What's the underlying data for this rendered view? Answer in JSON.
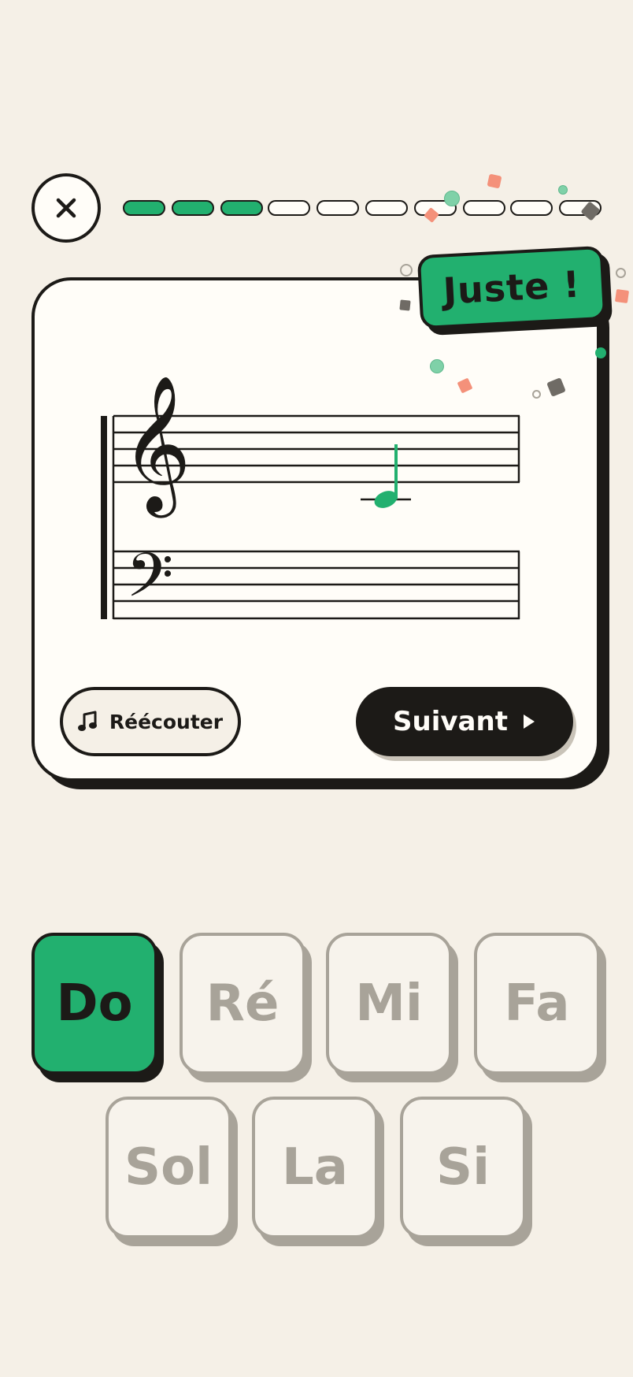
{
  "header": {
    "close_icon": "close-icon",
    "progress": {
      "total": 10,
      "completed": 3
    }
  },
  "feedback": {
    "label": "Juste !",
    "color": "#22b06f"
  },
  "staff": {
    "clefs": [
      "treble-clef",
      "bass-clef"
    ],
    "note_symbol": "quarter-note",
    "note_color": "#22b06f"
  },
  "actions": {
    "replay_label": "Réécouter",
    "replay_icon": "music-note-icon",
    "next_label": "Suivant",
    "next_icon": "play-arrow-icon"
  },
  "answers": {
    "row1": [
      {
        "label": "Do",
        "state": "correct"
      },
      {
        "label": "Ré",
        "state": "disabled"
      },
      {
        "label": "Mi",
        "state": "disabled"
      },
      {
        "label": "Fa",
        "state": "disabled"
      }
    ],
    "row2": [
      {
        "label": "Sol",
        "state": "disabled"
      },
      {
        "label": "La",
        "state": "disabled"
      },
      {
        "label": "Si",
        "state": "disabled"
      }
    ]
  },
  "colors": {
    "background": "#f5f0e7",
    "accent_green": "#22b06f",
    "ink": "#1c1a17",
    "muted": "#a8a399",
    "confetti_salmon": "#f4917a",
    "confetti_mint": "#7fd1a8",
    "confetti_gray": "#6f6b65"
  }
}
